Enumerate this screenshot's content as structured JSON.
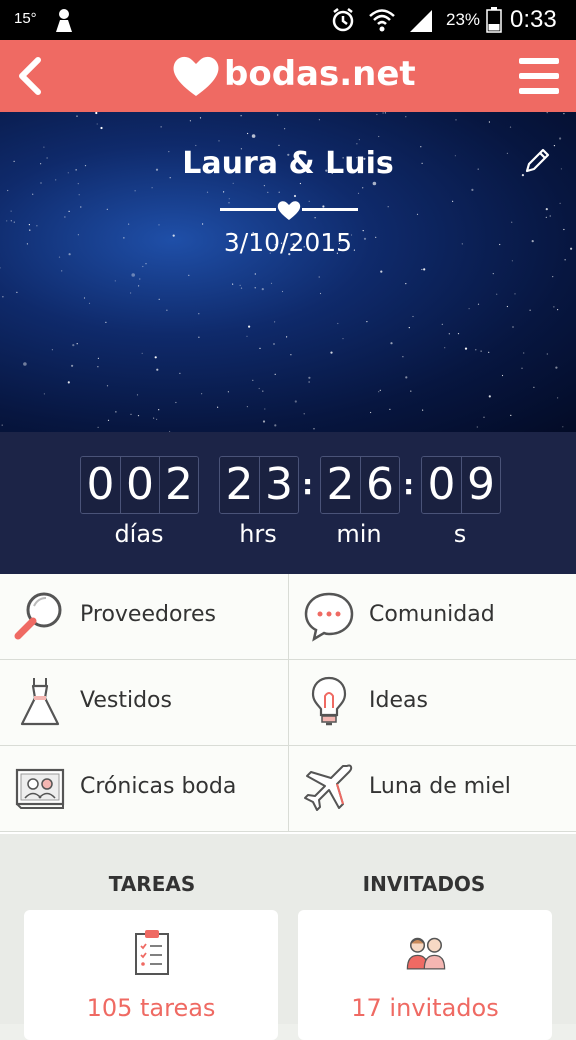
{
  "status_bar": {
    "temperature": "15°",
    "battery": "23%",
    "time": "0:33",
    "icons": [
      "notification-icon",
      "alarm-icon",
      "wifi-icon",
      "signal-icon",
      "battery-icon"
    ]
  },
  "app_bar": {
    "logo_text": "bodas.net",
    "brand_color": "#ef6a63",
    "icons": [
      "back-icon",
      "heart-logo-icon",
      "menu-icon"
    ]
  },
  "hero": {
    "couple": "Laura & Luis",
    "date": "3/10/2015",
    "icons": [
      "heart-divider-icon",
      "edit-pencil-icon"
    ]
  },
  "countdown": {
    "days": [
      "0",
      "0",
      "2"
    ],
    "hours": [
      "2",
      "3"
    ],
    "minutes": [
      "2",
      "6"
    ],
    "seconds": [
      "0",
      "9"
    ],
    "labels": {
      "days": "días",
      "hours": "hrs",
      "minutes": "min",
      "seconds": "s"
    },
    "separator": ":"
  },
  "menu": {
    "items": [
      {
        "label": "Proveedores",
        "icon": "magnifier-icon"
      },
      {
        "label": "Comunidad",
        "icon": "chat-bubble-icon"
      },
      {
        "label": "Vestidos",
        "icon": "dress-icon"
      },
      {
        "label": "Ideas",
        "icon": "lightbulb-icon"
      },
      {
        "label": "Crónicas boda",
        "icon": "photo-album-icon"
      },
      {
        "label": "Luna de miel",
        "icon": "airplane-icon"
      }
    ]
  },
  "summary": {
    "tasks": {
      "title": "TAREAS",
      "value": "105 tareas",
      "icon": "clipboard-icon"
    },
    "guests": {
      "title": "INVITADOS",
      "value": "17 invitados",
      "icon": "guests-icon"
    }
  }
}
